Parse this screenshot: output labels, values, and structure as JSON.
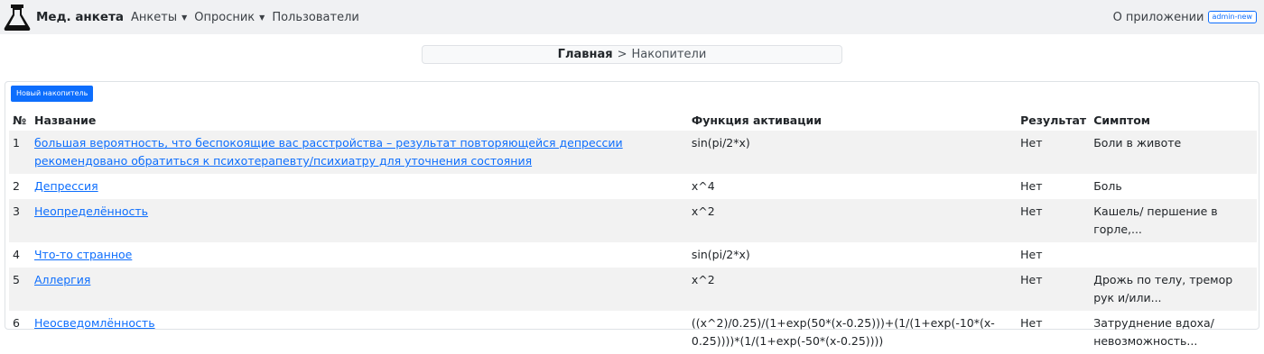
{
  "navbar": {
    "brand": "Мед. анкета",
    "items": [
      {
        "label": "Анкеты",
        "dropdown": true
      },
      {
        "label": "Опросник",
        "dropdown": true
      },
      {
        "label": "Пользователи",
        "dropdown": false
      }
    ],
    "about": "О приложении",
    "user": "admin-new",
    "icons": {
      "brand": "flask-icon",
      "caret": "caret-down-icon"
    }
  },
  "breadcrumb": {
    "home": "Главная",
    "separator": ">",
    "current": "Накопители"
  },
  "toolbar": {
    "new_button": "Новый накопитель"
  },
  "table": {
    "headers": {
      "num": "№",
      "name": "Название",
      "func": "Функция активации",
      "result": "Результат",
      "symptom": "Симптом"
    },
    "rows": [
      {
        "num": "1",
        "name": "большая вероятность, что беспокоящие вас расстройства – результат повторяющейся депрессии рекомендовано обратиться к психотерапевту/психиатру для уточнения состояния",
        "func": "sin(pi/2*x)",
        "result": "Нет",
        "symptom": "Боли в животе"
      },
      {
        "num": "2",
        "name": "Депрессия",
        "func": "x^4",
        "result": "Нет",
        "symptom": "Боль"
      },
      {
        "num": "3",
        "name": "Неопределённость",
        "func": "x^2",
        "result": "Нет",
        "symptom": "Кашель/ першение в горле,..."
      },
      {
        "num": "4",
        "name": "Что-то странное",
        "func": "sin(pi/2*x)",
        "result": "Нет",
        "symptom": ""
      },
      {
        "num": "5",
        "name": "Аллергия",
        "func": "x^2",
        "result": "Нет",
        "symptom": "Дрожь по телу, тремор рук и/или..."
      },
      {
        "num": "6",
        "name": "Неосведомлённость",
        "func": "((x^2)/0.25)/(1+exp(50*(x-0.25)))+(1/(1+exp(-10*(x-0.25))))*(1/(1+exp(-50*(x-0.25))))",
        "result": "Нет",
        "symptom": "Затруднение вдоха/ невозможность..."
      }
    ]
  },
  "colors": {
    "primary": "#0d6efd",
    "navbar_bg": "#f0f1f3",
    "stripe": "#f2f2f2"
  }
}
